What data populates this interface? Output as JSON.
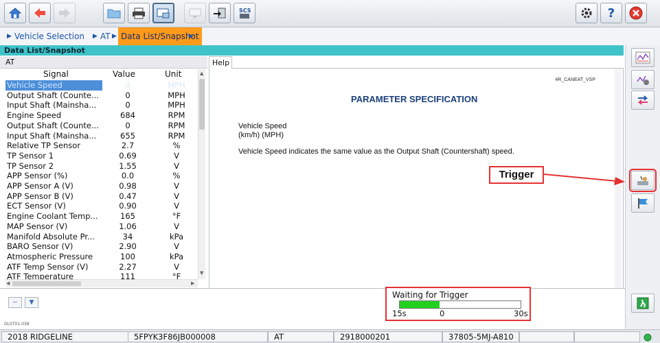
{
  "toolbar": {
    "icons": [
      "home-icon",
      "back-icon",
      "forward-icon",
      "folder-icon",
      "print-icon",
      "snapshot-icon",
      "monitor-icon",
      "export-icon",
      "scs-icon",
      "settings-icon",
      "help-icon",
      "close-icon"
    ],
    "scs_label": "SCS",
    "help_label": "?"
  },
  "breadcrumb": {
    "items": [
      "Vehicle Selection",
      "AT",
      "Data List/Snapshot"
    ]
  },
  "panel": {
    "title": "Data List/Snapshot",
    "subtitle": "AT",
    "help_tab": "Help"
  },
  "table": {
    "headers": [
      "Signal",
      "Value",
      "Unit"
    ],
    "rows": [
      {
        "signal": "Vehicle Speed",
        "value": "0",
        "unit": "MPH"
      },
      {
        "signal": "Output Shaft (Counte...",
        "value": "0",
        "unit": "MPH"
      },
      {
        "signal": "Input Shaft (Mainsha...",
        "value": "0",
        "unit": "MPH"
      },
      {
        "signal": "Engine Speed",
        "value": "684",
        "unit": "RPM"
      },
      {
        "signal": "Output Shaft (Counte...",
        "value": "0",
        "unit": "RPM"
      },
      {
        "signal": "Input Shaft (Mainsha...",
        "value": "655",
        "unit": "RPM"
      },
      {
        "signal": "Relative TP Sensor",
        "value": "2.7",
        "unit": "%"
      },
      {
        "signal": "TP Sensor 1",
        "value": "0.69",
        "unit": "V"
      },
      {
        "signal": "TP Sensor 2",
        "value": "1.55",
        "unit": "V"
      },
      {
        "signal": "APP Sensor (%)",
        "value": "0.0",
        "unit": "%"
      },
      {
        "signal": "APP Sensor A (V)",
        "value": "0.98",
        "unit": "V"
      },
      {
        "signal": "APP Sensor B (V)",
        "value": "0.47",
        "unit": "V"
      },
      {
        "signal": "ECT Sensor (V)",
        "value": "0.90",
        "unit": "V"
      },
      {
        "signal": "Engine Coolant Temp...",
        "value": "165",
        "unit": "°F"
      },
      {
        "signal": "MAP Sensor (V)",
        "value": "1.06",
        "unit": "V"
      },
      {
        "signal": "Manifold Absolute Pr...",
        "value": "34",
        "unit": "kPa"
      },
      {
        "signal": "BARO Sensor (V)",
        "value": "2.90",
        "unit": "V"
      },
      {
        "signal": "Atmospheric Pressure",
        "value": "100",
        "unit": "kPa"
      },
      {
        "signal": "ATF Temp Sensor (V)",
        "value": "2.27",
        "unit": "V"
      },
      {
        "signal": "ATF Temperature",
        "value": "111",
        "unit": "°F"
      }
    ]
  },
  "help": {
    "code": "4R_CANEAT_VSP",
    "heading": "PARAMETER SPECIFICATION",
    "param_name": "Vehicle Speed",
    "param_units": "(km/h) (MPH)",
    "description": "Vehicle Speed indicates the same value as the Output Shaft (Countershaft) speed."
  },
  "trigger": {
    "label": "Trigger"
  },
  "rightbar": {
    "icons": [
      "graph-icon",
      "graph-settings-icon",
      "swap-icon",
      "trigger-icon",
      "flag-icon",
      "exit-icon"
    ]
  },
  "bottom": {
    "code": "DLST01-038",
    "wait": {
      "title": "Waiting for Trigger",
      "start_label": "15s",
      "mid_label": "0",
      "end_label": "30s",
      "progress_fraction": 0.33
    }
  },
  "status": {
    "cells": [
      "2018 RIDGELINE",
      "5FPYK3F86JB000008",
      "AT",
      "2918000201",
      "37805-5MJ-A810",
      "",
      ""
    ]
  },
  "colors": {
    "accent": "#3fc3c8",
    "highlight": "#ff9a1a",
    "alert": "#e53030",
    "progress": "#22d11e"
  }
}
